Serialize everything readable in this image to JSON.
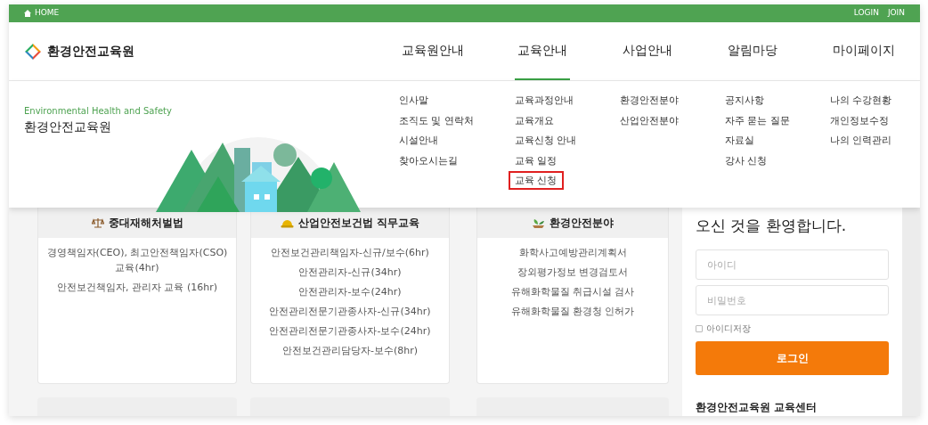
{
  "top_bar": {
    "home": "HOME",
    "links": [
      "LOGIN",
      "JOIN"
    ]
  },
  "logo": {
    "text": "환경안전교육원"
  },
  "nav": [
    {
      "label": "교육원안내",
      "selected": false
    },
    {
      "label": "교육안내",
      "selected": true
    },
    {
      "label": "사업안내",
      "selected": false
    },
    {
      "label": "알림마당",
      "selected": false
    },
    {
      "label": "마이페이지",
      "selected": false
    }
  ],
  "mega_menu": {
    "subtitle": "Environmental Health and Safety",
    "title": "환경안전교육원",
    "columns": [
      [
        {
          "label": "인사말",
          "highlighted": false
        },
        {
          "label": "조직도 및 연락처",
          "highlighted": false
        },
        {
          "label": "시설안내",
          "highlighted": false
        },
        {
          "label": "찾아오시는길",
          "highlighted": false
        }
      ],
      [
        {
          "label": "교육과정안내",
          "highlighted": false
        },
        {
          "label": "교육개요",
          "highlighted": false
        },
        {
          "label": "교육신청 안내",
          "highlighted": false
        },
        {
          "label": "교육 일정",
          "highlighted": false
        },
        {
          "label": "교육 신청",
          "highlighted": true
        }
      ],
      [
        {
          "label": "환경안전분야",
          "highlighted": false
        },
        {
          "label": "산업안전분야",
          "highlighted": false
        }
      ],
      [
        {
          "label": "공지사항",
          "highlighted": false
        },
        {
          "label": "자주 묻는 질문",
          "highlighted": false
        },
        {
          "label": "자료실",
          "highlighted": false
        },
        {
          "label": "강사 신청",
          "highlighted": false
        }
      ],
      [
        {
          "label": "나의 수강현황",
          "highlighted": false
        },
        {
          "label": "개인정보수정",
          "highlighted": false
        },
        {
          "label": "나의 인력관리",
          "highlighted": false
        }
      ]
    ]
  },
  "cards": [
    {
      "kind": "scales",
      "title": "중대재해처벌법",
      "items": [
        "경영책임자(CEO), 최고안전책임자(CSO) 교육(4hr)",
        "안전보건책임자, 관리자 교육 (16hr)"
      ]
    },
    {
      "kind": "helmet",
      "title": "산업안전보건법 직무교육",
      "items": [
        "안전보건관리책임자-신규/보수(6hr)",
        "안전관리자-신규(34hr)",
        "안전관리자-보수(24hr)",
        "안전관리전문기관종사자-신규(34hr)",
        "안전관리전문기관종사자-보수(24hr)",
        "안전보건관리담당자-보수(8hr)"
      ]
    },
    {
      "kind": "plant",
      "title": "환경안전분야",
      "items": [
        "화학사고예방관리계획서",
        "장외평가정보 변경검토서",
        "유해화학물질 취급시설 검사",
        "유해화학물질 환경청 인허가"
      ]
    }
  ],
  "login": {
    "welcome": "오신 것을 환영합니다.",
    "id_placeholder": "아이디",
    "password_placeholder": "비밀번호",
    "remember": {
      "label": "아이디저장",
      "checked": false
    },
    "button": "로그인",
    "center_title": "환경안전교육원 교육센터"
  }
}
